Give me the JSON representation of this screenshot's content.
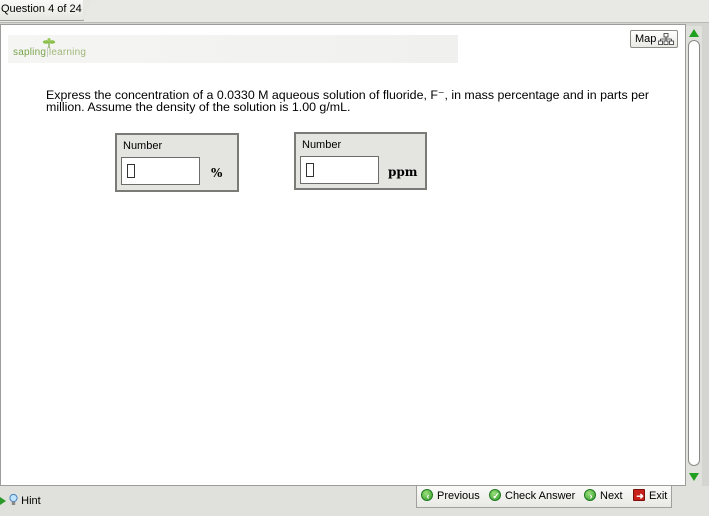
{
  "tab": {
    "label": "Question 4 of 24"
  },
  "brand": {
    "part1": "sapling",
    "part2": "learning"
  },
  "map_button": {
    "label": "Map"
  },
  "question": {
    "text": "Express the concentration of a 0.0330 M aqueous solution of fluoride, F⁻, in mass percentage and in parts per million. Assume the density of the solution is 1.00 g/mL."
  },
  "answers": [
    {
      "label": "Number",
      "value": "",
      "unit": "%"
    },
    {
      "label": "Number",
      "value": "",
      "unit": "ppm"
    }
  ],
  "hint": {
    "label": "Hint"
  },
  "nav": {
    "previous": "Previous",
    "check": "Check Answer",
    "next": "Next",
    "exit": "Exit"
  },
  "colors": {
    "accent_green": "#2f9a2a",
    "exit_red": "#c8201a",
    "brand_green": "#7aa44c"
  }
}
